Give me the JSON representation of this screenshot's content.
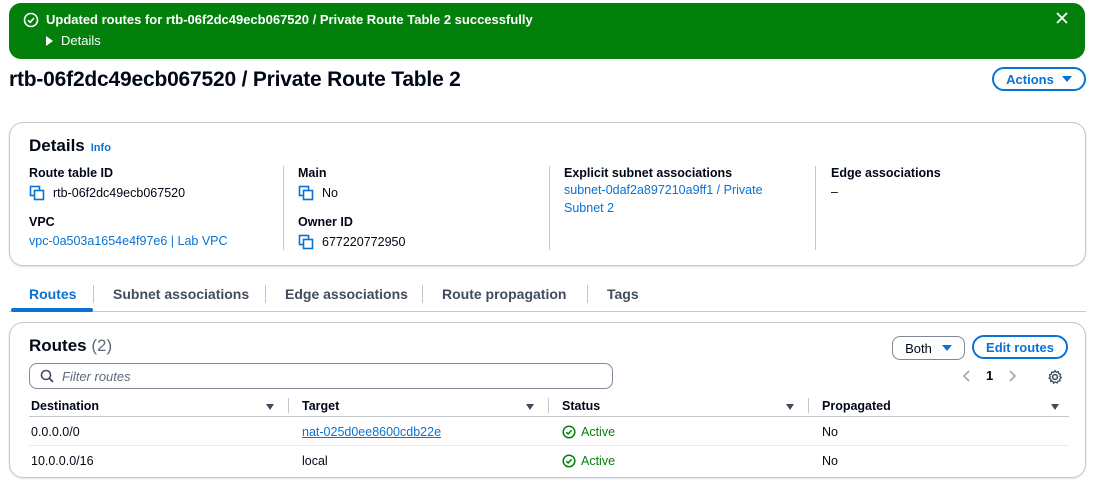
{
  "flash": {
    "message": "Updated routes for rtb-06f2dc49ecb067520 / Private Route Table 2 successfully",
    "details_label": "Details"
  },
  "page": {
    "title": "rtb-06f2dc49ecb067520 / Private Route Table 2",
    "actions_label": "Actions"
  },
  "details": {
    "heading": "Details",
    "info_label": "Info",
    "route_table_id_label": "Route table ID",
    "route_table_id": "rtb-06f2dc49ecb067520",
    "vpc_label": "VPC",
    "vpc": "vpc-0a503a1654e4f97e6 | Lab VPC",
    "main_label": "Main",
    "main": "No",
    "owner_id_label": "Owner ID",
    "owner_id": "677220772950",
    "explicit_label": "Explicit subnet associations",
    "explicit_value": "subnet-0daf2a897210a9ff1 / Private Subnet 2",
    "edge_label": "Edge associations",
    "edge_value": "–"
  },
  "tabs": [
    "Routes",
    "Subnet associations",
    "Edge associations",
    "Route propagation",
    "Tags"
  ],
  "routes": {
    "title": "Routes",
    "count": "(2)",
    "filter_label": "Both",
    "edit_label": "Edit routes",
    "search_placeholder": "Filter routes",
    "page_number": "1",
    "columns": [
      "Destination",
      "Target",
      "Status",
      "Propagated"
    ],
    "rows": [
      {
        "destination": "0.0.0.0/0",
        "target": "nat-025d0ee8600cdb22e",
        "status": "Active",
        "propagated": "No"
      },
      {
        "destination": "10.0.0.0/16",
        "target": "local",
        "status": "Active",
        "propagated": "No"
      }
    ]
  },
  "colors": {
    "success": "#037f0c",
    "link": "#0972d3",
    "border": "#c6c6cd"
  }
}
